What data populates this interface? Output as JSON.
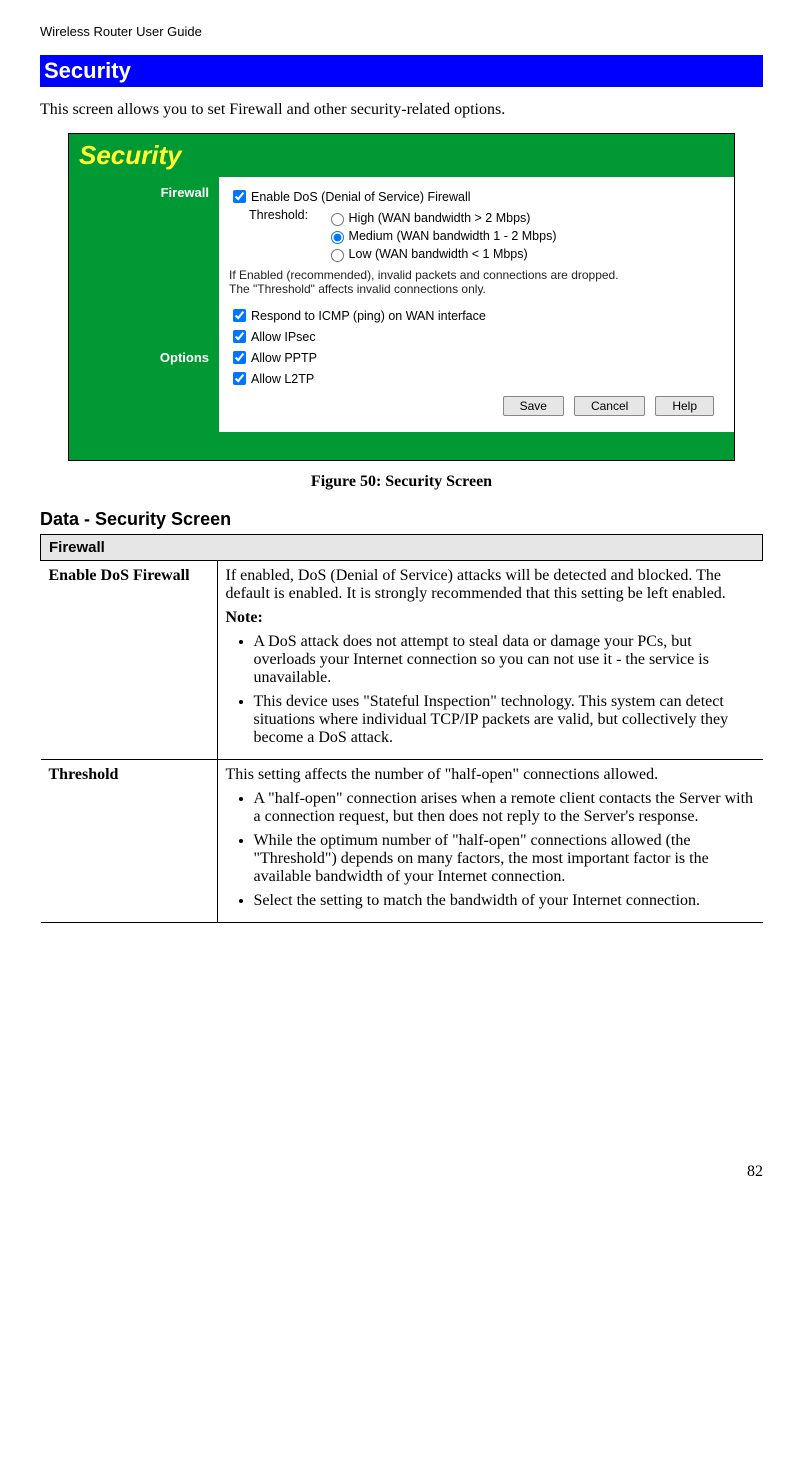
{
  "header": "Wireless Router User Guide",
  "section_title": "Security",
  "intro": "This screen allows you to set Firewall and other security-related options.",
  "figure_caption": "Figure 50: Security Screen",
  "subhead": "Data - Security Screen",
  "page_number": "82",
  "screenshot": {
    "title": "Security",
    "left": {
      "firewall": "Firewall",
      "options": "Options"
    },
    "firewall": {
      "enable_dos": "Enable DoS (Denial of Service) Firewall",
      "threshold_label": "Threshold:",
      "radio_high": "High (WAN bandwidth > 2 Mbps)",
      "radio_medium": "Medium (WAN bandwidth 1 - 2 Mbps)",
      "radio_low": "Low (WAN bandwidth < 1 Mbps)",
      "note1": "If Enabled (recommended), invalid packets and connections are dropped.",
      "note2": "The \"Threshold\" affects invalid connections only."
    },
    "options": {
      "icmp": "Respond to ICMP (ping) on WAN interface",
      "ipsec": "Allow IPsec",
      "pptp": "Allow PPTP",
      "l2tp": "Allow L2TP"
    },
    "buttons": {
      "save": "Save",
      "cancel": "Cancel",
      "help": "Help"
    }
  },
  "table": {
    "section": "Firewall",
    "row1": {
      "label": "Enable DoS Firewall",
      "p1": "If enabled, DoS (Denial of Service) attacks will be detected and blocked. The default is enabled. It is strongly recommended that this setting be left enabled.",
      "note_label": "Note:",
      "b1": "A DoS attack does not attempt to steal data or damage your PCs, but overloads your Internet connection so you can not use it - the service is unavailable.",
      "b2": "This device uses \"Stateful Inspection\" technology. This system can detect situations where individual TCP/IP packets are valid, but collectively they become a DoS attack."
    },
    "row2": {
      "label": "Threshold",
      "p1": "This setting affects the number of \"half-open\" connections allowed.",
      "b1": "A \"half-open\" connection arises when a remote client contacts the Server with a connection request, but then does not reply to the Server's response.",
      "b2": "While the optimum number of \"half-open\" connections allowed (the \"Threshold\") depends on many factors, the most important factor is the available bandwidth of your Internet connection.",
      "b3": "Select the setting to match the bandwidth of your Internet connection."
    }
  }
}
